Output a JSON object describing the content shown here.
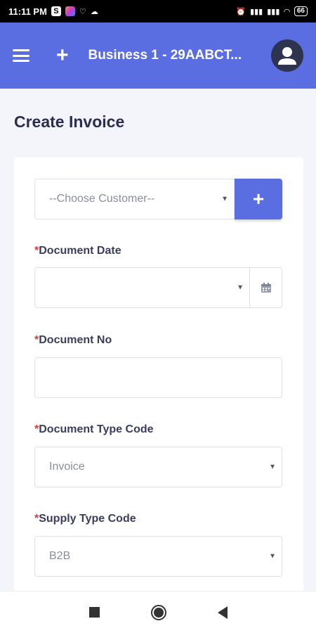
{
  "status_bar": {
    "time": "11:11 PM",
    "battery": "66",
    "icons": [
      "s-app-icon",
      "gallery-icon",
      "messenger-icon",
      "cloud-icon",
      "alarm-icon",
      "volte-signal-icon",
      "volte-signal-icon-2",
      "wifi-icon",
      "battery-icon"
    ]
  },
  "header": {
    "menu_icon": "hamburger-icon",
    "add_icon": "plus-icon",
    "business_name": "Business 1 - 29AABCT...",
    "avatar_icon": "user-avatar-icon",
    "bg_color": "#5b6ee1"
  },
  "page": {
    "title": "Create Invoice"
  },
  "form": {
    "customer_placeholder": "--Choose Customer--",
    "add_customer_label": "+",
    "document_date": {
      "required_mark": "*",
      "label": "Document Date",
      "value": ""
    },
    "document_no": {
      "required_mark": "*",
      "label": "Document No",
      "value": ""
    },
    "document_type_code": {
      "required_mark": "*",
      "label": "Document Type Code",
      "value": "Invoice"
    },
    "supply_type_code": {
      "required_mark": "*",
      "label": "Supply Type Code",
      "value": "B2B"
    }
  },
  "nav": {
    "recents_icon": "square-recents-icon",
    "home_icon": "circle-home-icon",
    "back_icon": "triangle-back-icon"
  }
}
